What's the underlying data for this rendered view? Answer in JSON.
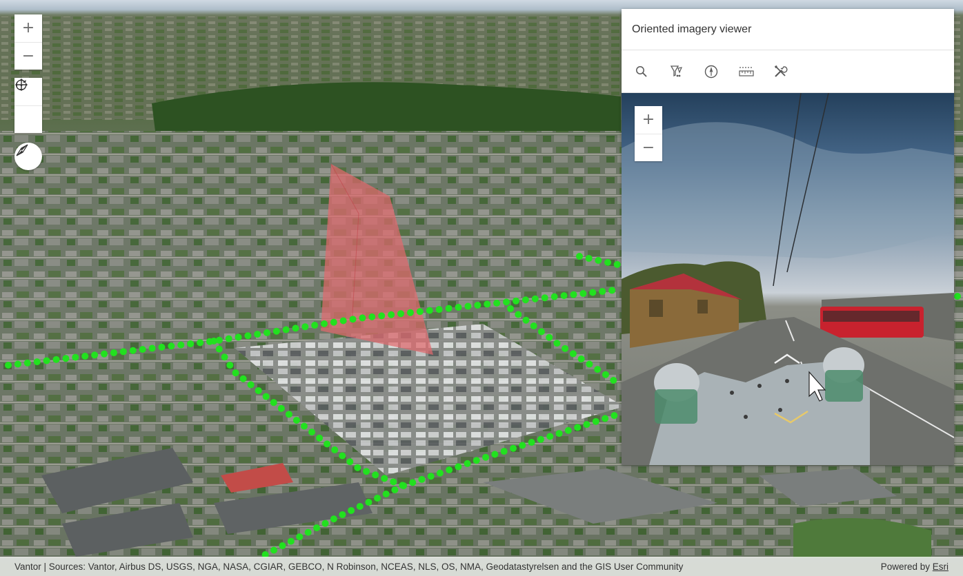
{
  "map": {
    "zoom_in_label": "+",
    "zoom_out_label": "−",
    "pan_icon": "pan-arrows-icon",
    "rotate_icon": "rotate-icon",
    "compass_icon": "compass-icon",
    "route_color": "#22e11f",
    "footprint_color": "#e0696d"
  },
  "panel": {
    "title": "Oriented imagery viewer",
    "tools": [
      {
        "name": "search-icon"
      },
      {
        "name": "filter-icon"
      },
      {
        "name": "orientation-icon"
      },
      {
        "name": "measure-icon"
      },
      {
        "name": "tools-icon"
      }
    ],
    "zoom_in_label": "+",
    "zoom_out_label": "−"
  },
  "attribution": {
    "sources": "Vantor | Sources: Vantor, Airbus DS, USGS, NGA, NASA, CGIAR, GEBCO, N Robinson, NCEAS, NLS, OS, NMA, Geodatastyrelsen and the GIS User Community",
    "powered_by": "Powered by ",
    "esri_link": "Esri"
  }
}
